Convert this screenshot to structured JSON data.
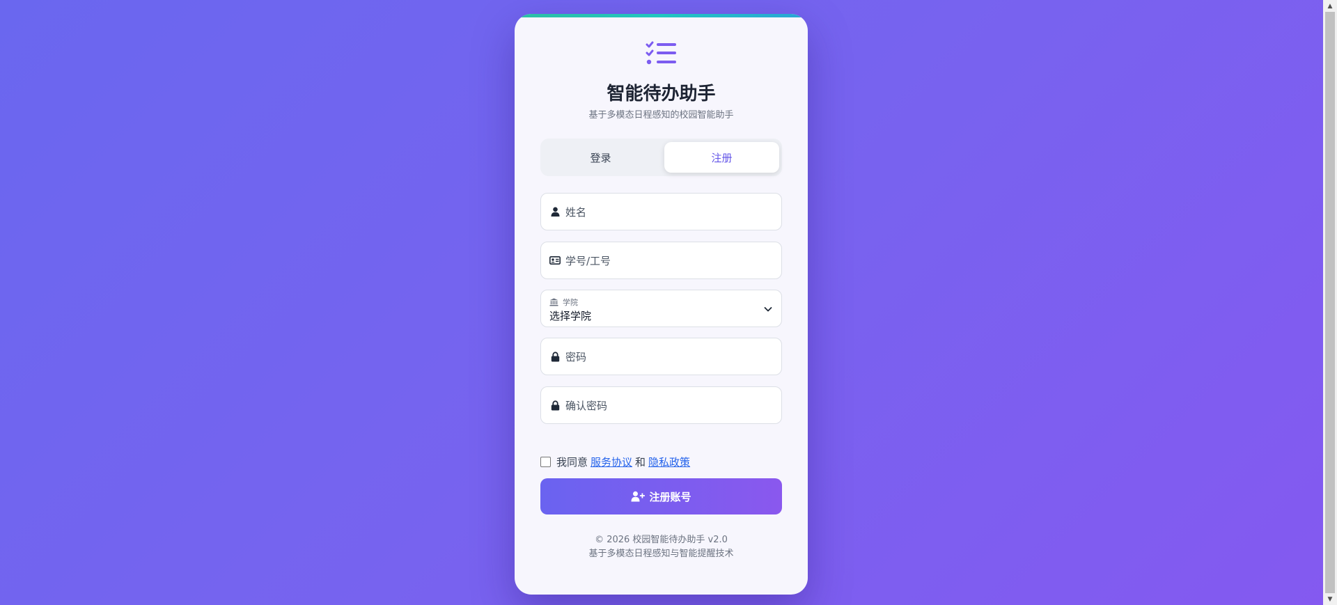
{
  "app": {
    "title": "智能待办助手",
    "subtitle": "基于多模态日程感知的校园智能助手"
  },
  "tabs": {
    "login": "登录",
    "register": "注册",
    "active": "register"
  },
  "form": {
    "name_placeholder": "姓名",
    "student_id_placeholder": "学号/工号",
    "college_label": "学院",
    "college_value": "选择学院",
    "password_placeholder": "密码",
    "confirm_password_placeholder": "确认密码"
  },
  "agreement": {
    "prefix": "我同意",
    "terms_link": "服务协议",
    "conjunction": "和",
    "privacy_link": "隐私政策",
    "checked": false
  },
  "submit": {
    "label": "注册账号",
    "icon": "user-plus-icon"
  },
  "footer": {
    "line1": "© 2026 校园智能待办助手 v2.0",
    "line2": "基于多模态日程感知与智能提醒技术"
  },
  "colors": {
    "accent": "#6254e8",
    "link": "#2563eb",
    "top_bar": "#22c6c0"
  }
}
